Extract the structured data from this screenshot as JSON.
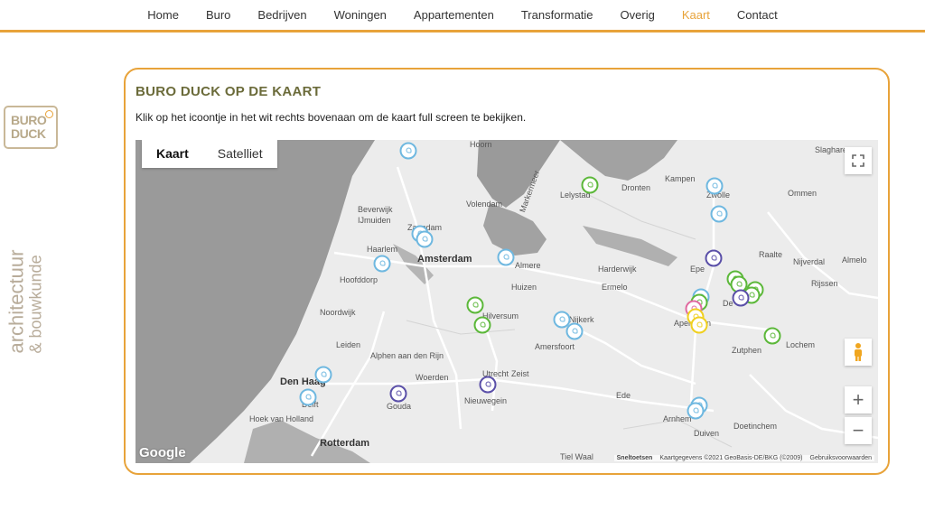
{
  "nav": {
    "items": [
      "Home",
      "Buro",
      "Bedrijven",
      "Woningen",
      "Appartementen",
      "Transformatie",
      "Overig",
      "Kaart",
      "Contact"
    ],
    "active": "Kaart"
  },
  "brand": {
    "logo_line1": "BURO",
    "logo_line2": "DUCK",
    "tagline1": "architectuur",
    "tagline2": "& bouwkunde",
    "accent": "#e8a33a"
  },
  "card": {
    "title": "BURO DUCK OP DE KAART",
    "description": "Klik op het icoontje in het wit rechts bovenaan om de kaart full screen te bekijken."
  },
  "map": {
    "types": [
      "Kaart",
      "Satelliet"
    ],
    "selected_type": "Kaart",
    "zoom_in": "+",
    "zoom_out": "−",
    "google": "Google",
    "shortcuts": "Sneltoetsen",
    "data_credit": "Kaartgegevens ©2021 GeoBasis-DE/BKG (©2009)",
    "terms": "Gebruiksvoorwaarden",
    "places": {
      "hoorn": "Hoorn",
      "volendam": "Volendam",
      "markermeer": "Markermeer",
      "lelystad": "Lelystad",
      "dronten": "Dronten",
      "kampen": "Kampen",
      "zwolle": "Zwolle",
      "slagharen": "Slagharen",
      "ommen": "Ommen",
      "raalte": "Raalte",
      "nijverdal": "Nijverdal",
      "almelo": "Almelo",
      "rijssen": "Rijssen",
      "beverwijk": "Beverwijk",
      "ijmuiden": "IJmuiden",
      "zaandam": "Zaandam",
      "haarlem": "Haarlem",
      "amsterdam": "Amsterdam",
      "almere": "Almere",
      "harderwijk": "Harderwijk",
      "epe": "Epe",
      "hoofddorp": "Hoofddorp",
      "huizen": "Huizen",
      "ermelo": "Ermelo",
      "noordwijk": "Noordwijk",
      "hilversum": "Hilversum",
      "nijkerk": "Nijkerk",
      "apeldoorn": "Apeldoorn",
      "deventer": "De",
      "leiden": "Leiden",
      "amersfoort": "Amersfoort",
      "zutphen": "Zutphen",
      "lochem": "Lochem",
      "alphen": "Alphen aan den Rijn",
      "denhaag": "Den Haag",
      "woerden": "Woerden",
      "utrecht": "Utrecht",
      "zeist": "Zeist",
      "ede": "Ede",
      "gouda": "Gouda",
      "nieuwegein": "Nieuwegein",
      "arnhem": "Arnhem",
      "hoek": "Hoek van Holland",
      "delft": "Delft",
      "doetinchem": "Doetinchem",
      "rotterdam": "Rotterdam",
      "duiven": "Duiven",
      "tielwaal": "Tiel Waal"
    },
    "marker_colors": {
      "blue": "#6fb8e0",
      "green": "#5cb83a",
      "purple": "#5a4fa8",
      "yellow": "#f0d020",
      "pink": "#e06aa0"
    }
  }
}
